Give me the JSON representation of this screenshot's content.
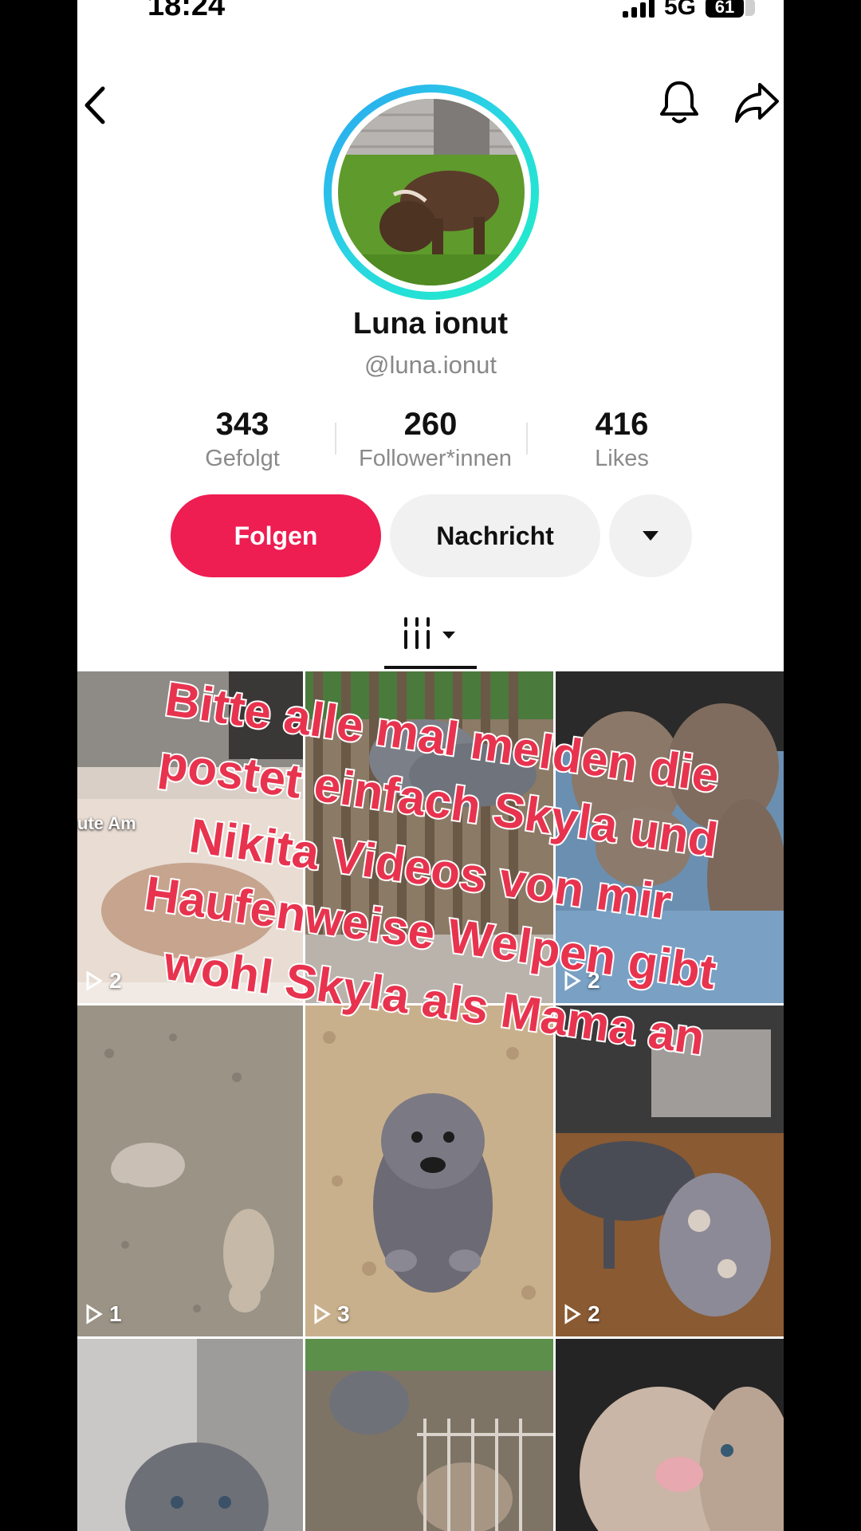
{
  "status_bar": {
    "time": "18:24",
    "network": "5G",
    "battery": "61"
  },
  "profile": {
    "name": "Luna ionut",
    "handle": "@luna.ionut"
  },
  "stats": [
    {
      "value": "343",
      "label": "Gefolgt"
    },
    {
      "value": "260",
      "label": "Follower*innen"
    },
    {
      "value": "416",
      "label": "Likes"
    }
  ],
  "actions": {
    "follow": "Folgen",
    "message": "Nachricht"
  },
  "videos": [
    {
      "views": "2",
      "caption": "ute Am"
    },
    {
      "views": ""
    },
    {
      "views": "2"
    },
    {
      "views": "1"
    },
    {
      "views": "3"
    },
    {
      "views": "2"
    },
    {
      "views": ""
    },
    {
      "views": ""
    },
    {
      "views": ""
    }
  ],
  "overlay_text": {
    "lines": [
      "Bitte alle mal melden die",
      "postet einfach Skyla und",
      "Nikita Videos von mir",
      "Haufenweise Welpen gibt",
      "wohl Skyla als Mama an"
    ],
    "color": "#e8334f"
  }
}
